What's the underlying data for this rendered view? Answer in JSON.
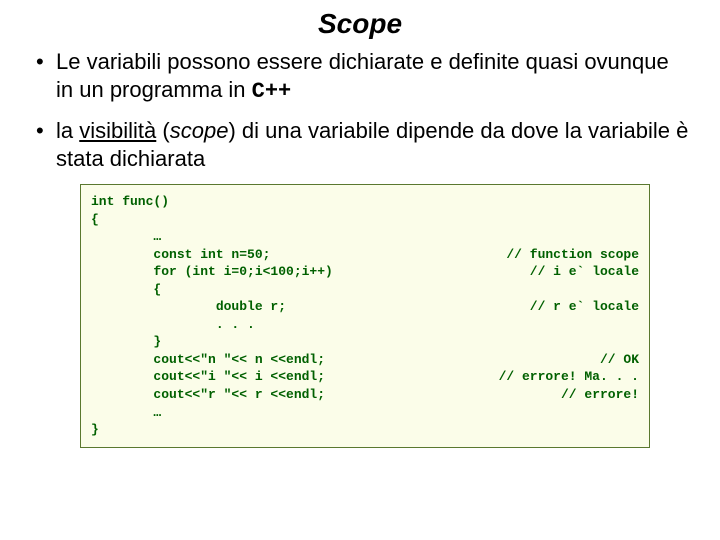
{
  "title": "Scope",
  "bullets": [
    {
      "pre": "Le variabili possono essere dichiarate e definite quasi ovunque in un programma in ",
      "mono": "C++"
    },
    {
      "parts": {
        "a": "la ",
        "vis": "visibilità",
        "b": " (",
        "scope": "scope",
        "c": ") di una variabile dipende da dove la variabile è stata dichiarata"
      }
    }
  ],
  "code": {
    "lines": [
      {
        "l": "int func()",
        "r": ""
      },
      {
        "l": "{",
        "r": ""
      },
      {
        "l": "        …",
        "r": ""
      },
      {
        "l": "        const int n=50;",
        "r": "// function scope"
      },
      {
        "l": "        for (int i=0;i<100;i++)",
        "r": "// i e` locale"
      },
      {
        "l": "        {",
        "r": ""
      },
      {
        "l": "                double r;",
        "r": "// r e` locale"
      },
      {
        "l": "                . . .",
        "r": ""
      },
      {
        "l": "        }",
        "r": ""
      },
      {
        "l": "        cout<<\"n \"<< n <<endl;",
        "r": "// OK"
      },
      {
        "l": "        cout<<\"i \"<< i <<endl;",
        "r": "// errore! Ma. . ."
      },
      {
        "l": "        cout<<\"r \"<< r <<endl;",
        "r": "// errore!"
      },
      {
        "l": "        …",
        "r": ""
      },
      {
        "l": "}",
        "r": ""
      }
    ]
  }
}
